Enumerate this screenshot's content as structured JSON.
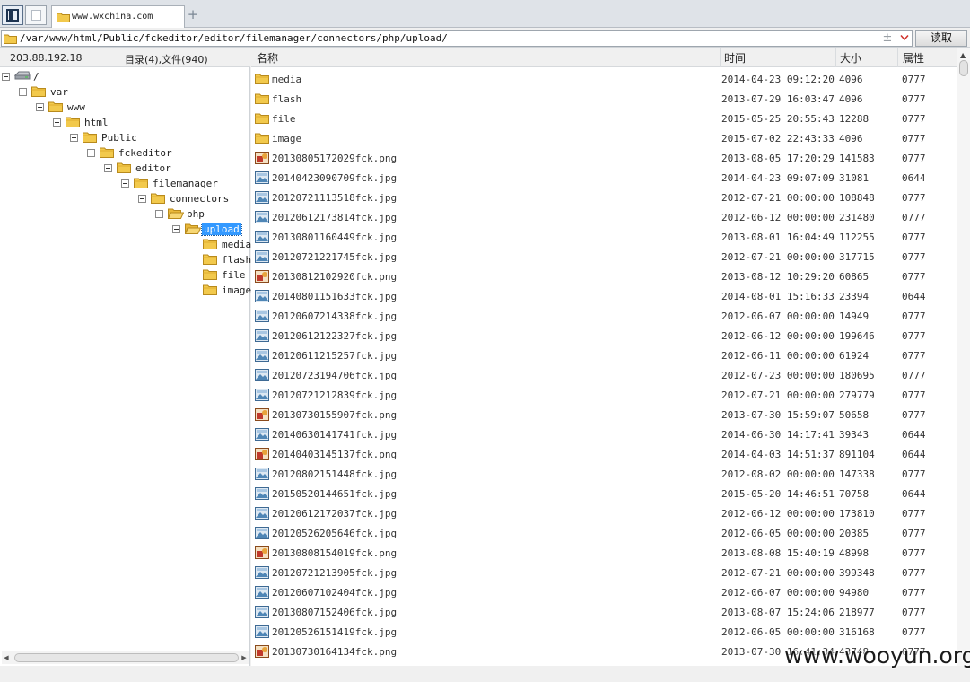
{
  "tab": {
    "title": "www.wxchina.com",
    "new_tab_label": "+"
  },
  "address_bar": {
    "path": "/var/www/html/Public/fckeditor/editor/filemanager/connectors/php/upload/",
    "stepper_label": "±",
    "read_button_label": "读取"
  },
  "left_panel": {
    "host_ip": "203.88.192.18",
    "dir_summary": "目录(4),文件(940)"
  },
  "tree": [
    {
      "label": "/",
      "icon": "drive-icon",
      "expander": true,
      "selected": false
    },
    {
      "label": "var",
      "icon": "folder-icon",
      "expander": true,
      "selected": false
    },
    {
      "label": "www",
      "icon": "folder-icon",
      "expander": true,
      "selected": false
    },
    {
      "label": "html",
      "icon": "folder-icon",
      "expander": true,
      "selected": false
    },
    {
      "label": "Public",
      "icon": "folder-icon",
      "expander": true,
      "selected": false
    },
    {
      "label": "fckeditor",
      "icon": "folder-icon",
      "expander": true,
      "selected": false
    },
    {
      "label": "editor",
      "icon": "folder-icon",
      "expander": true,
      "selected": false
    },
    {
      "label": "filemanager",
      "icon": "folder-icon",
      "expander": true,
      "selected": false
    },
    {
      "label": "connectors",
      "icon": "folder-icon",
      "expander": true,
      "selected": false
    },
    {
      "label": "php",
      "icon": "folder-open-icon",
      "expander": true,
      "selected": false
    },
    {
      "label": "upload",
      "icon": "folder-open-icon",
      "expander": true,
      "selected": true
    },
    {
      "label": "media",
      "icon": "folder-icon",
      "expander": false,
      "selected": false
    },
    {
      "label": "flash",
      "icon": "folder-icon",
      "expander": false,
      "selected": false
    },
    {
      "label": "file",
      "icon": "folder-icon",
      "expander": false,
      "selected": false
    },
    {
      "label": "image",
      "icon": "folder-icon",
      "expander": false,
      "selected": false
    }
  ],
  "columns": {
    "name": "名称",
    "time": "时间",
    "size": "大小",
    "attr": "属性"
  },
  "files": [
    {
      "name": "media",
      "type": "folder",
      "time": "2014-04-23 09:12:20",
      "size": "4096",
      "attr": "0777"
    },
    {
      "name": "flash",
      "type": "folder",
      "time": "2013-07-29 16:03:47",
      "size": "4096",
      "attr": "0777"
    },
    {
      "name": "file",
      "type": "folder",
      "time": "2015-05-25 20:55:43",
      "size": "12288",
      "attr": "0777"
    },
    {
      "name": "image",
      "type": "folder",
      "time": "2015-07-02 22:43:33",
      "size": "4096",
      "attr": "0777"
    },
    {
      "name": "20130805172029fck.png",
      "type": "png",
      "time": "2013-08-05 17:20:29",
      "size": "141583",
      "attr": "0777"
    },
    {
      "name": "20140423090709fck.jpg",
      "type": "jpg",
      "time": "2014-04-23 09:07:09",
      "size": "31081",
      "attr": "0644"
    },
    {
      "name": "20120721113518fck.jpg",
      "type": "jpg",
      "time": "2012-07-21 00:00:00",
      "size": "108848",
      "attr": "0777"
    },
    {
      "name": "20120612173814fck.jpg",
      "type": "jpg",
      "time": "2012-06-12 00:00:00",
      "size": "231480",
      "attr": "0777"
    },
    {
      "name": "20130801160449fck.jpg",
      "type": "jpg",
      "time": "2013-08-01 16:04:49",
      "size": "112255",
      "attr": "0777"
    },
    {
      "name": "20120721221745fck.jpg",
      "type": "jpg",
      "time": "2012-07-21 00:00:00",
      "size": "317715",
      "attr": "0777"
    },
    {
      "name": "20130812102920fck.png",
      "type": "png",
      "time": "2013-08-12 10:29:20",
      "size": "60865",
      "attr": "0777"
    },
    {
      "name": "20140801151633fck.jpg",
      "type": "jpg",
      "time": "2014-08-01 15:16:33",
      "size": "23394",
      "attr": "0644"
    },
    {
      "name": "20120607214338fck.jpg",
      "type": "jpg",
      "time": "2012-06-07 00:00:00",
      "size": "14949",
      "attr": "0777"
    },
    {
      "name": "20120612122327fck.jpg",
      "type": "jpg",
      "time": "2012-06-12 00:00:00",
      "size": "199646",
      "attr": "0777"
    },
    {
      "name": "20120611215257fck.jpg",
      "type": "jpg",
      "time": "2012-06-11 00:00:00",
      "size": "61924",
      "attr": "0777"
    },
    {
      "name": "20120723194706fck.jpg",
      "type": "jpg",
      "time": "2012-07-23 00:00:00",
      "size": "180695",
      "attr": "0777"
    },
    {
      "name": "20120721212839fck.jpg",
      "type": "jpg",
      "time": "2012-07-21 00:00:00",
      "size": "279779",
      "attr": "0777"
    },
    {
      "name": "20130730155907fck.png",
      "type": "png",
      "time": "2013-07-30 15:59:07",
      "size": "50658",
      "attr": "0777"
    },
    {
      "name": "20140630141741fck.jpg",
      "type": "jpg",
      "time": "2014-06-30 14:17:41",
      "size": "39343",
      "attr": "0644"
    },
    {
      "name": "20140403145137fck.png",
      "type": "png",
      "time": "2014-04-03 14:51:37",
      "size": "891104",
      "attr": "0644"
    },
    {
      "name": "20120802151448fck.jpg",
      "type": "jpg",
      "time": "2012-08-02 00:00:00",
      "size": "147338",
      "attr": "0777"
    },
    {
      "name": "20150520144651fck.jpg",
      "type": "jpg",
      "time": "2015-05-20 14:46:51",
      "size": "70758",
      "attr": "0644"
    },
    {
      "name": "20120612172037fck.jpg",
      "type": "jpg",
      "time": "2012-06-12 00:00:00",
      "size": "173810",
      "attr": "0777"
    },
    {
      "name": "20120526205646fck.jpg",
      "type": "jpg",
      "time": "2012-06-05 00:00:00",
      "size": "20385",
      "attr": "0777"
    },
    {
      "name": "20130808154019fck.png",
      "type": "png",
      "time": "2013-08-08 15:40:19",
      "size": "48998",
      "attr": "0777"
    },
    {
      "name": "20120721213905fck.jpg",
      "type": "jpg",
      "time": "2012-07-21 00:00:00",
      "size": "399348",
      "attr": "0777"
    },
    {
      "name": "20120607102404fck.jpg",
      "type": "jpg",
      "time": "2012-06-07 00:00:00",
      "size": "94980",
      "attr": "0777"
    },
    {
      "name": "20130807152406fck.jpg",
      "type": "jpg",
      "time": "2013-08-07 15:24:06",
      "size": "218977",
      "attr": "0777"
    },
    {
      "name": "20120526151419fck.jpg",
      "type": "jpg",
      "time": "2012-06-05 00:00:00",
      "size": "316168",
      "attr": "0777"
    },
    {
      "name": "20130730164134fck.png",
      "type": "png",
      "time": "2013-07-30 16:41:34",
      "size": "43748",
      "attr": "0777"
    }
  ],
  "watermark": "www.wooyun.org",
  "colors": {
    "selection": "#3399ff",
    "folder": "#f2c94c",
    "folder_stroke": "#b88a1c"
  }
}
